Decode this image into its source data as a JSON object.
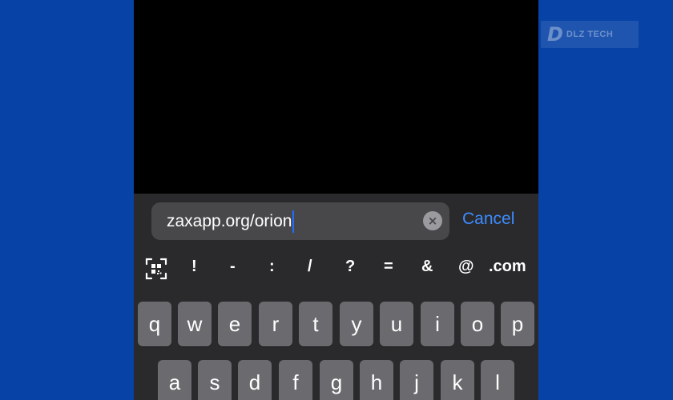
{
  "watermark": {
    "logo_glyph": "D",
    "text": "DLZ TECH"
  },
  "address_bar": {
    "url_value": "zaxapp.org/orion",
    "clear_icon": "×",
    "cancel_label": "Cancel"
  },
  "keyboard": {
    "shortcuts": [
      "!",
      "-",
      ":",
      "/",
      "?",
      "=",
      "&",
      "@",
      ".com"
    ],
    "row1": [
      "q",
      "w",
      "e",
      "r",
      "t",
      "y",
      "u",
      "i",
      "o",
      "p"
    ],
    "row2": [
      "a",
      "s",
      "d",
      "f",
      "g",
      "h",
      "j",
      "k",
      "l"
    ]
  },
  "colors": {
    "background": "#0742a6",
    "accent": "#3d8bff",
    "caret": "#1e6fff",
    "keyboard_bg": "#2a2a2c",
    "key_bg": "#6b6b6f"
  }
}
